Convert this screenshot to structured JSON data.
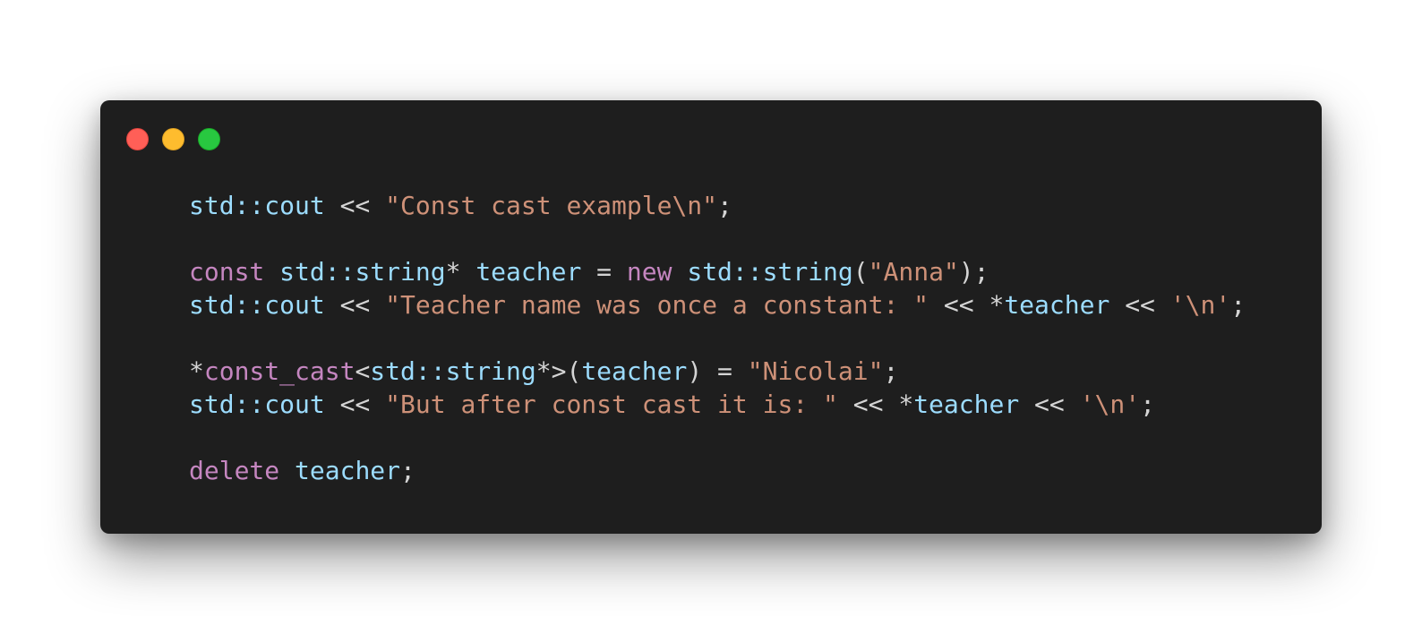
{
  "window": {
    "traffic_lights": [
      {
        "name": "close",
        "color": "#ff5f57"
      },
      {
        "name": "minimize",
        "color": "#febc2e"
      },
      {
        "name": "zoom",
        "color": "#28c840"
      }
    ]
  },
  "theme": {
    "background": "#1e1e1e",
    "identifier": "#9cdcfe",
    "keyword": "#c586c0",
    "string": "#ce9178",
    "punctuation": "#d4d4d4"
  },
  "code": {
    "lines": [
      {
        "tokens": [
          {
            "t": "std::cout",
            "k": "ident"
          },
          {
            "t": " << ",
            "k": "punct"
          },
          {
            "t": "\"Const cast example\\n\"",
            "k": "string"
          },
          {
            "t": ";",
            "k": "punct"
          }
        ]
      },
      {
        "tokens": []
      },
      {
        "tokens": [
          {
            "t": "const",
            "k": "keyword"
          },
          {
            "t": " ",
            "k": "punct"
          },
          {
            "t": "std::string",
            "k": "ident"
          },
          {
            "t": "* ",
            "k": "punct"
          },
          {
            "t": "teacher",
            "k": "ident"
          },
          {
            "t": " = ",
            "k": "punct"
          },
          {
            "t": "new",
            "k": "keyword"
          },
          {
            "t": " ",
            "k": "punct"
          },
          {
            "t": "std::string",
            "k": "ident"
          },
          {
            "t": "(",
            "k": "punct"
          },
          {
            "t": "\"Anna\"",
            "k": "string"
          },
          {
            "t": ");",
            "k": "punct"
          }
        ]
      },
      {
        "tokens": [
          {
            "t": "std::cout",
            "k": "ident"
          },
          {
            "t": " << ",
            "k": "punct"
          },
          {
            "t": "\"Teacher name was once a constant: \"",
            "k": "string"
          },
          {
            "t": " << *",
            "k": "punct"
          },
          {
            "t": "teacher",
            "k": "ident"
          },
          {
            "t": " << ",
            "k": "punct"
          },
          {
            "t": "'\\n'",
            "k": "string"
          },
          {
            "t": ";",
            "k": "punct"
          }
        ]
      },
      {
        "tokens": []
      },
      {
        "tokens": [
          {
            "t": "*",
            "k": "punct"
          },
          {
            "t": "const_cast",
            "k": "keyword"
          },
          {
            "t": "<",
            "k": "punct"
          },
          {
            "t": "std::string",
            "k": "ident"
          },
          {
            "t": "*>(",
            "k": "punct"
          },
          {
            "t": "teacher",
            "k": "ident"
          },
          {
            "t": ") = ",
            "k": "punct"
          },
          {
            "t": "\"Nicolai\"",
            "k": "string"
          },
          {
            "t": ";",
            "k": "punct"
          }
        ]
      },
      {
        "tokens": [
          {
            "t": "std::cout",
            "k": "ident"
          },
          {
            "t": " << ",
            "k": "punct"
          },
          {
            "t": "\"But after const cast it is: \"",
            "k": "string"
          },
          {
            "t": " << *",
            "k": "punct"
          },
          {
            "t": "teacher",
            "k": "ident"
          },
          {
            "t": " << ",
            "k": "punct"
          },
          {
            "t": "'\\n'",
            "k": "string"
          },
          {
            "t": ";",
            "k": "punct"
          }
        ]
      },
      {
        "tokens": []
      },
      {
        "tokens": [
          {
            "t": "delete",
            "k": "keyword"
          },
          {
            "t": " ",
            "k": "punct"
          },
          {
            "t": "teacher",
            "k": "ident"
          },
          {
            "t": ";",
            "k": "punct"
          }
        ]
      }
    ]
  }
}
